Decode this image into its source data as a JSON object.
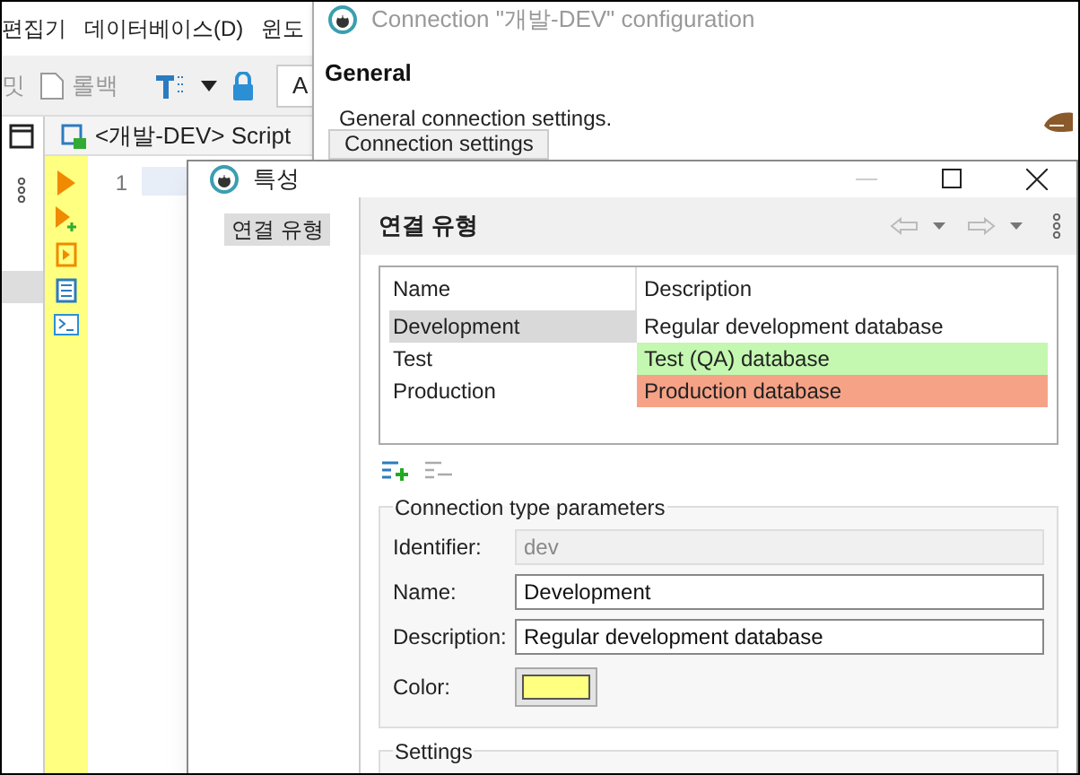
{
  "ide": {
    "menu": [
      "편집기",
      "데이터베이스(D)",
      "윈도"
    ],
    "toolbar": {
      "commit_partial": "밋",
      "rollback": "롤백",
      "field_value": "A"
    },
    "editor_tab": "<개발-DEV> Script",
    "line_numbers": [
      "1"
    ]
  },
  "config_window": {
    "title": "Connection \"개발-DEV\" configuration",
    "heading": "General",
    "subtitle": "General connection settings.",
    "tab": "Connection settings"
  },
  "dialog": {
    "title": "특성",
    "nav": [
      {
        "label": "연결 유형",
        "selected": true
      }
    ],
    "header": "연결 유형",
    "table": {
      "columns": [
        "Name",
        "Description"
      ],
      "rows": [
        {
          "name": "Development",
          "description": "Regular development database",
          "color": "#ffffff",
          "selected": true
        },
        {
          "name": "Test",
          "description": "Test (QA) database",
          "color": "#c4f7b0",
          "selected": false
        },
        {
          "name": "Production",
          "description": "Production database",
          "color": "#f5a287",
          "selected": false
        }
      ]
    },
    "group": {
      "title": "Connection type parameters",
      "fields": [
        {
          "label": "Identifier:",
          "value": "dev",
          "disabled": true
        },
        {
          "label": "Name:",
          "value": "Development",
          "disabled": false
        },
        {
          "label": "Description:",
          "value": "Regular development database",
          "disabled": false
        }
      ],
      "color_field": {
        "label": "Color:",
        "color": "#ffff80"
      }
    },
    "settings_title": "Settings"
  }
}
